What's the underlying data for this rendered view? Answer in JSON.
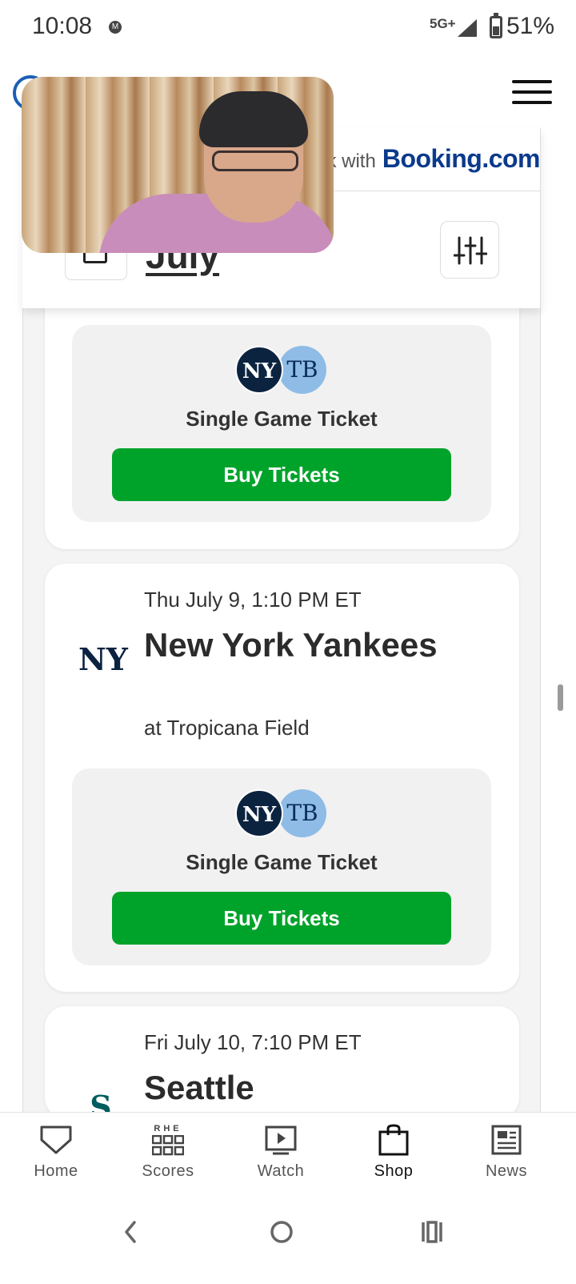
{
  "status_bar": {
    "time": "10:08",
    "notification": "M",
    "network": "5G+",
    "battery": "51%",
    "battery_level": 0.51
  },
  "header": {
    "menu_icon": "hamburger-icon"
  },
  "sponsor": {
    "prefix": "k with",
    "brand": "Booking.com",
    "brand_color": "#0b3a8c"
  },
  "filters": {
    "month": "July",
    "calendar_icon": "calendar-icon",
    "filter_icon": "sliders-icon"
  },
  "games": [
    {
      "ticket_type": "Single Game Ticket",
      "buy_label": "Buy Tickets",
      "logos": {
        "home": "NY",
        "away": "TB"
      }
    },
    {
      "date": "Thu July 9, 1:10 PM ET",
      "team": "New York Yankees",
      "venue": "at Tropicana Field",
      "team_logo": "NY",
      "ticket_type": "Single Game Ticket",
      "buy_label": "Buy Tickets",
      "logos": {
        "home": "NY",
        "away": "TB"
      }
    },
    {
      "date": "Fri July 10, 7:10 PM ET",
      "team": "Seattle",
      "team_logo": "S"
    }
  ],
  "colors": {
    "buy_button": "#00a32a",
    "yankees_navy": "#0c2340",
    "rays_blue": "#8fbce6"
  },
  "bottom_nav": [
    {
      "label": "Home",
      "icon": "home-plate-icon"
    },
    {
      "label": "Scores",
      "icon": "scoreboard-icon",
      "icon_text": "RHE"
    },
    {
      "label": "Watch",
      "icon": "video-icon"
    },
    {
      "label": "Shop",
      "icon": "shopping-bag-icon",
      "active": true
    },
    {
      "label": "News",
      "icon": "newspaper-icon"
    }
  ],
  "system_nav": [
    "back-icon",
    "home-circle-icon",
    "recents-icon"
  ]
}
